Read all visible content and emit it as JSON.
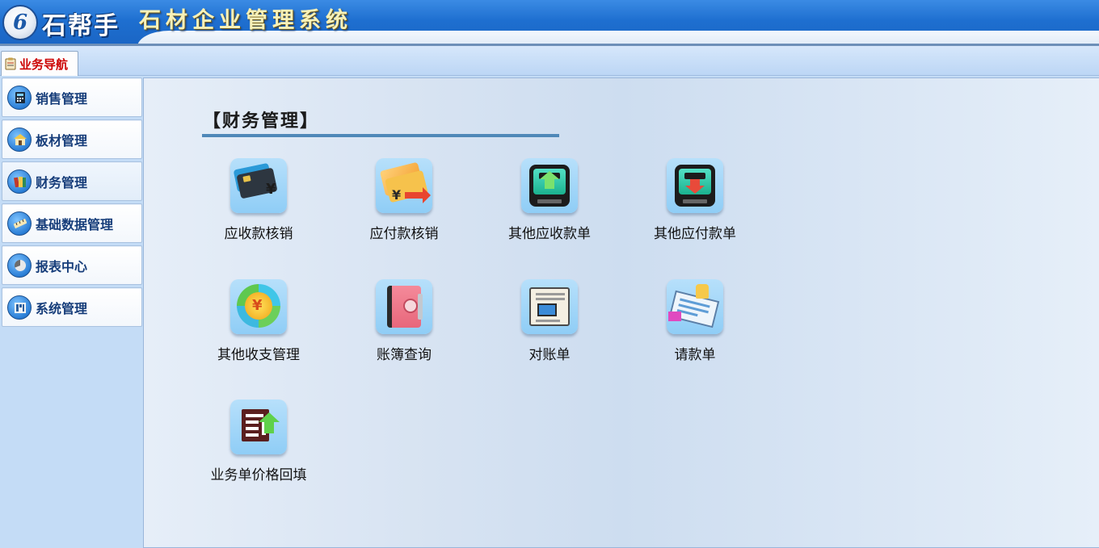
{
  "header": {
    "logo_text": "石帮手",
    "logo_badge": "6",
    "system_title": "石材企业管理系统"
  },
  "tabs": [
    {
      "label": "业务导航",
      "icon": "clipboard-icon",
      "active": true
    }
  ],
  "sidebar": {
    "items": [
      {
        "label": "销售管理",
        "icon": "calculator-icon",
        "active": false
      },
      {
        "label": "板材管理",
        "icon": "house-icon",
        "active": false
      },
      {
        "label": "财务管理",
        "icon": "books-icon",
        "active": true
      },
      {
        "label": "基础数据管理",
        "icon": "ruler-icon",
        "active": false
      },
      {
        "label": "报表中心",
        "icon": "chart-icon",
        "active": false
      },
      {
        "label": "系统管理",
        "icon": "building-icon",
        "active": false
      }
    ]
  },
  "main": {
    "section_title": "【财务管理】",
    "tiles": [
      {
        "label": "应收款核销",
        "icon": "card-receive-icon"
      },
      {
        "label": "应付款核销",
        "icon": "card-pay-icon"
      },
      {
        "label": "其他应收款单",
        "icon": "pos-in-icon"
      },
      {
        "label": "其他应付款单",
        "icon": "pos-out-icon"
      },
      {
        "label": "其他收支管理",
        "icon": "coin-ring-icon"
      },
      {
        "label": "账簿查询",
        "icon": "ledger-book-icon"
      },
      {
        "label": "对账单",
        "icon": "statement-icon"
      },
      {
        "label": "请款单",
        "icon": "request-doc-icon"
      },
      {
        "label": "业务单价格回填",
        "icon": "price-backfill-icon"
      }
    ]
  },
  "colors": {
    "header_blue": "#1e6fd0",
    "title_gold": "#f7f1b8",
    "tab_red": "#cc0000",
    "sidebar_text": "#163d7a",
    "rule": "#4f88b8"
  }
}
